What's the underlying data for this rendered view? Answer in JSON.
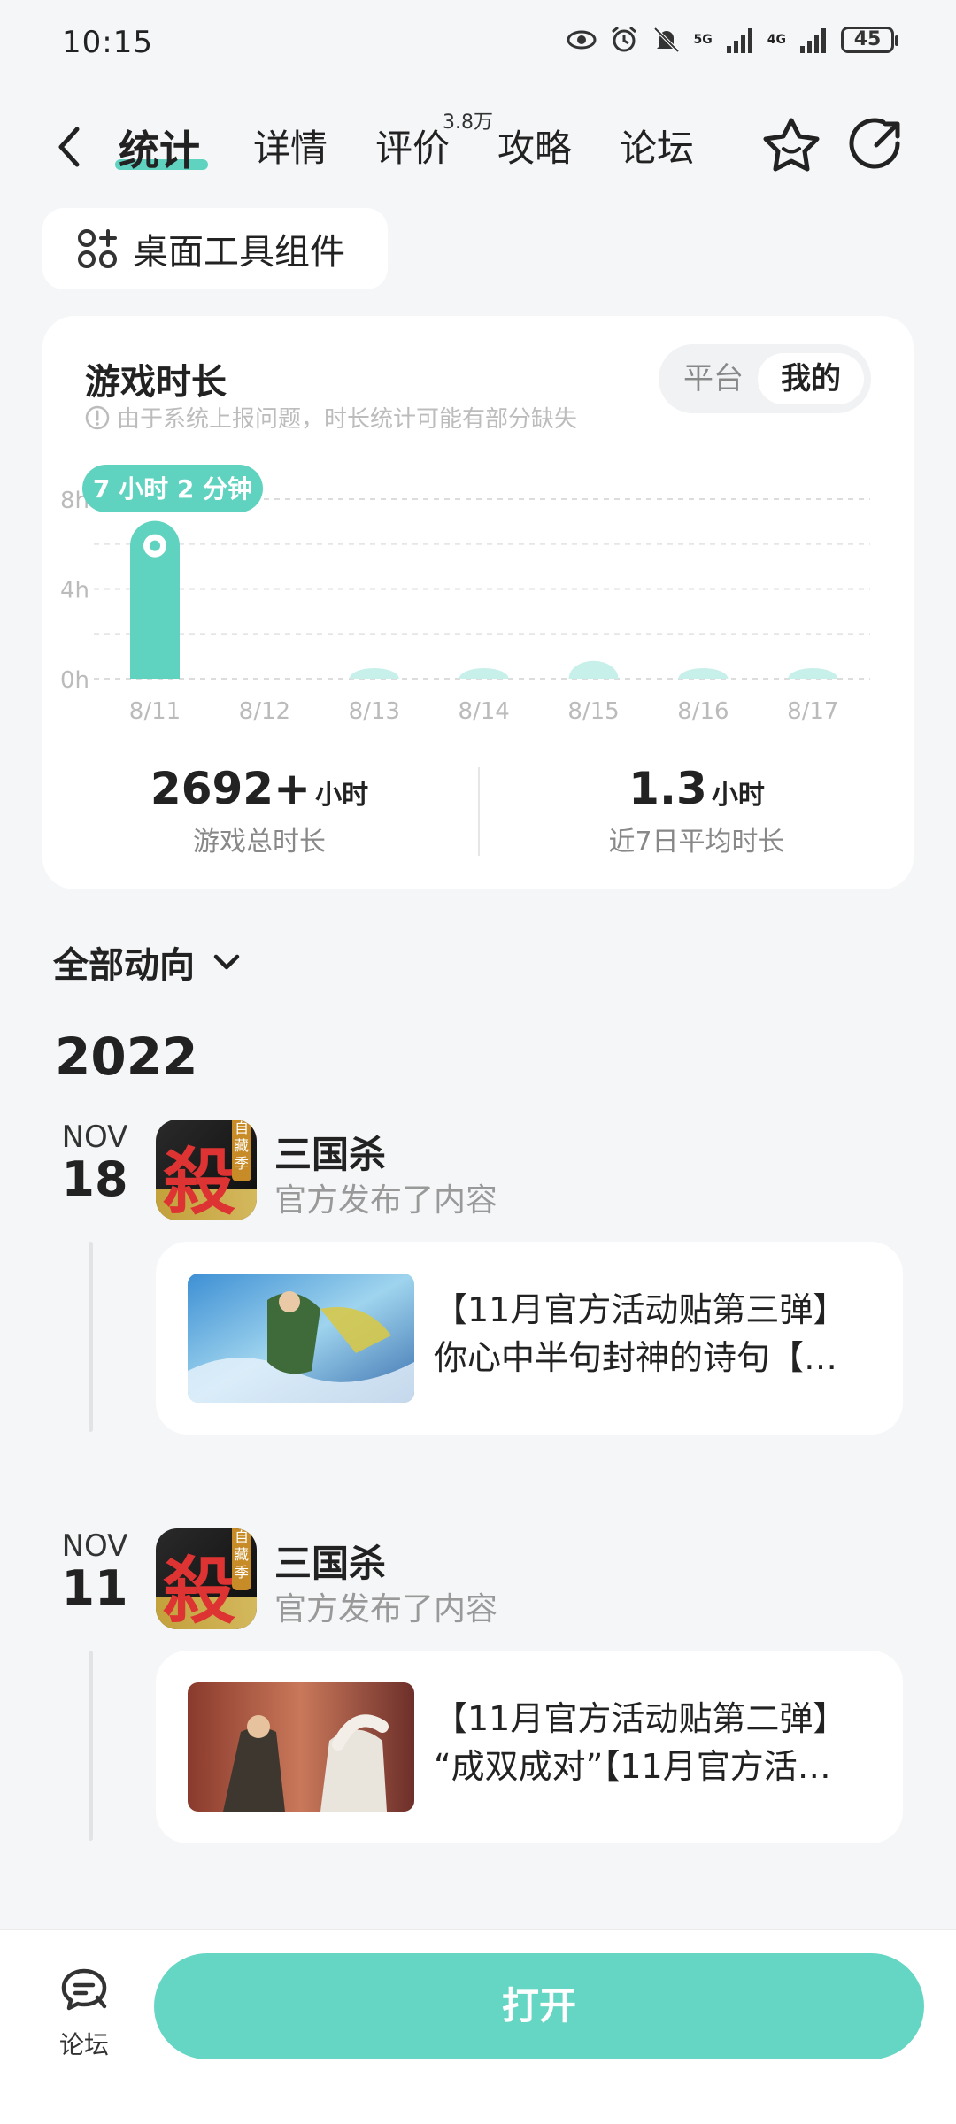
{
  "status_bar": {
    "time": "10:15",
    "network_1": "5G",
    "network_2": "4G",
    "battery": "45"
  },
  "nav": {
    "tabs": [
      {
        "label": "统计",
        "active": true
      },
      {
        "label": "详情"
      },
      {
        "label": "评价"
      },
      {
        "label": "攻略"
      },
      {
        "label": "论坛"
      }
    ],
    "review_count": "3.8万"
  },
  "widget_button": "桌面工具组件",
  "stats_card": {
    "title": "游戏时长",
    "note": "由于系统上报问题，时长统计可能有部分缺失",
    "toggle": {
      "options": [
        "平台",
        "我的"
      ],
      "selected": "我的"
    },
    "tooltip": "7 小时 2 分钟",
    "total_value": "2692+",
    "total_unit": "小时",
    "total_label": "游戏总时长",
    "avg_value": "1.3",
    "avg_unit": "小时",
    "avg_label": "近7日平均时长"
  },
  "chart_data": {
    "type": "bar",
    "categories": [
      "8/11",
      "8/12",
      "8/13",
      "8/14",
      "8/15",
      "8/16",
      "8/17"
    ],
    "values": [
      7.03,
      0,
      0.1,
      0.1,
      0.8,
      0.1,
      0.1
    ],
    "ylim": [
      0,
      8
    ],
    "yticks": [
      "0h",
      "4h",
      "8h"
    ],
    "highlight_index": 0,
    "colors": {
      "highlight": "#5fd3c0",
      "normal": "#c8f0ea"
    }
  },
  "feed": {
    "filter_label": "全部动向",
    "year": "2022",
    "items": [
      {
        "month": "NOV",
        "day": "18",
        "app_name": "三国杀",
        "app_icon_glyph": "殺",
        "app_icon_tag": "自藏季",
        "action": "官方发布了内容",
        "post_line1": "【11月官方活动贴第三弹】",
        "post_line2": "你心中半句封神的诗句【…"
      },
      {
        "month": "NOV",
        "day": "11",
        "app_name": "三国杀",
        "app_icon_glyph": "殺",
        "app_icon_tag": "自藏季",
        "action": "官方发布了内容",
        "post_line1": "【11月官方活动贴第二弹】",
        "post_line2": "“成双成对”【11月官方活…"
      }
    ]
  },
  "bottom": {
    "forum_label": "论坛",
    "open_label": "打开"
  },
  "colors": {
    "accent": "#66d6c4",
    "background": "#f5f6f8"
  }
}
